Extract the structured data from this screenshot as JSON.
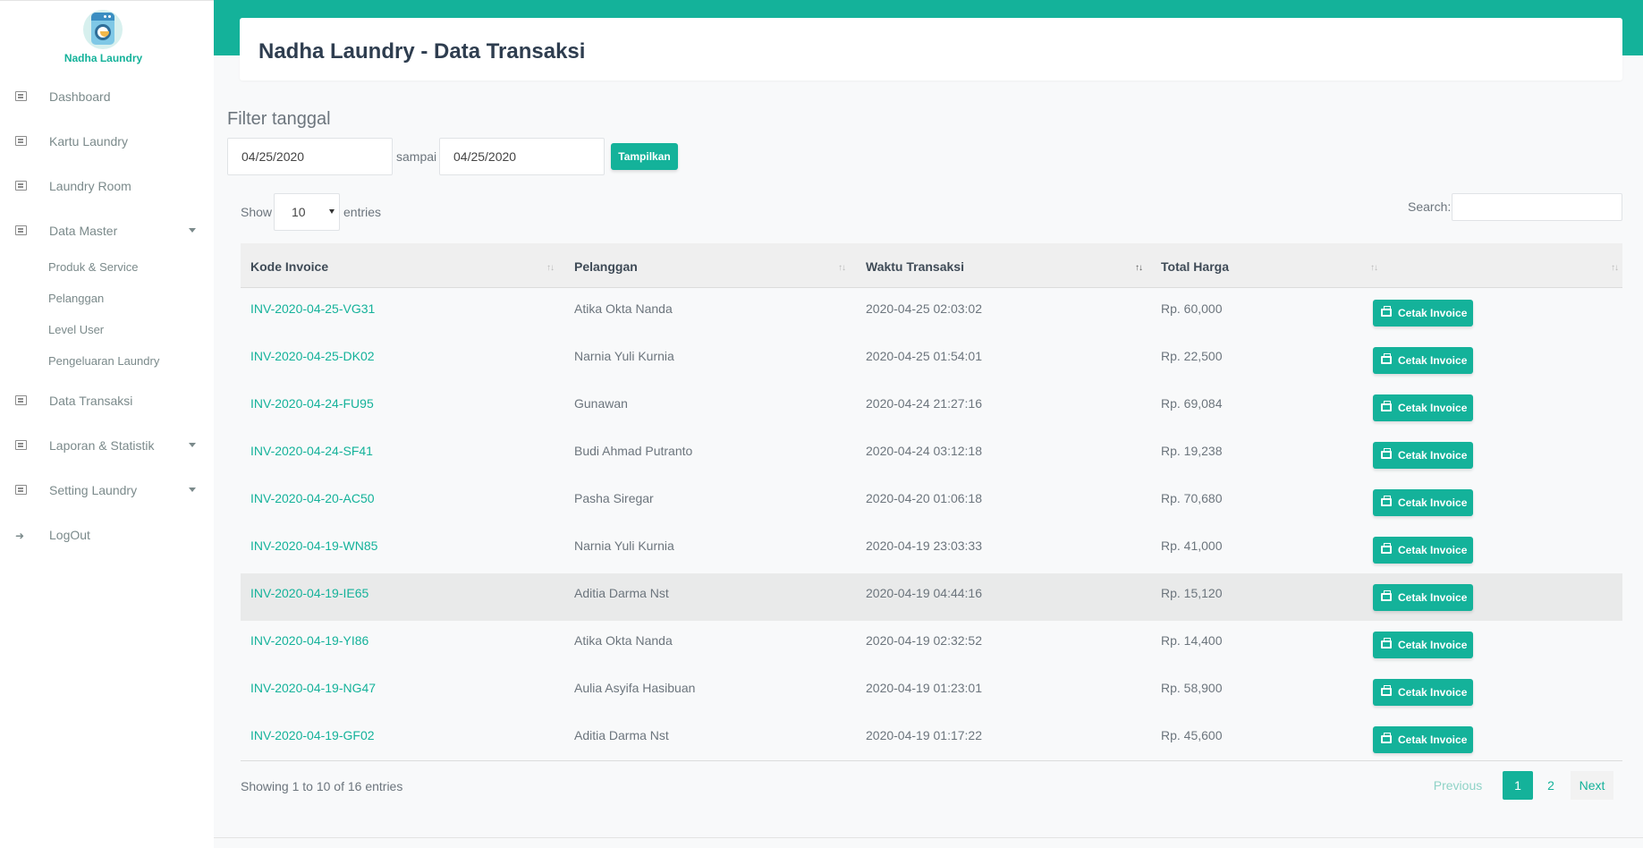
{
  "brand": {
    "name": "Nadha Laundry"
  },
  "sidebar": {
    "items": [
      {
        "label": "Dashboard",
        "icon": "list-icon"
      },
      {
        "label": "Kartu Laundry",
        "icon": "list-icon"
      },
      {
        "label": "Laundry Room",
        "icon": "list-icon"
      },
      {
        "label": "Data Master",
        "icon": "list-icon",
        "expanded": true
      },
      {
        "label": "Data Transaksi",
        "icon": "list-icon"
      },
      {
        "label": "Laporan & Statistik",
        "icon": "list-icon"
      },
      {
        "label": "Setting Laundry",
        "icon": "list-icon"
      },
      {
        "label": "LogOut",
        "icon": "logout-icon"
      }
    ],
    "submenu": [
      "Produk & Service",
      "Pelanggan",
      "Level User",
      "Pengeluaran Laundry"
    ]
  },
  "header": {
    "title": "Nadha Laundry - Data Transaksi"
  },
  "filter": {
    "title": "Filter tanggal",
    "date_from": "04/25/2020",
    "separator": "sampai",
    "date_to": "04/25/2020",
    "button": "Tampilkan"
  },
  "table_controls": {
    "show_label": "Show",
    "entries_value": "10",
    "entries_label": "entries",
    "search_label": "Search:"
  },
  "table": {
    "columns": [
      "Kode Invoice",
      "Pelanggan",
      "Waktu Transaksi",
      "Total Harga",
      ""
    ],
    "action_label": "Cetak Invoice",
    "rows": [
      [
        "INV-2020-04-25-VG31",
        "Atika Okta Nanda",
        "2020-04-25 02:03:02",
        "Rp. 60,000"
      ],
      [
        "INV-2020-04-25-DK02",
        "Narnia Yuli Kurnia",
        "2020-04-25 01:54:01",
        "Rp. 22,500"
      ],
      [
        "INV-2020-04-24-FU95",
        "Gunawan",
        "2020-04-24 21:27:16",
        "Rp. 69,084"
      ],
      [
        "INV-2020-04-24-SF41",
        "Budi Ahmad Putranto",
        "2020-04-24 03:12:18",
        "Rp. 19,238"
      ],
      [
        "INV-2020-04-20-AC50",
        "Pasha Siregar",
        "2020-04-20 01:06:18",
        "Rp. 70,680"
      ],
      [
        "INV-2020-04-19-WN85",
        "Narnia Yuli Kurnia",
        "2020-04-19 23:03:33",
        "Rp. 41,000"
      ],
      [
        "INV-2020-04-19-IE65",
        "Aditia Darma Nst",
        "2020-04-19 04:44:16",
        "Rp. 15,120"
      ],
      [
        "INV-2020-04-19-YI86",
        "Atika Okta Nanda",
        "2020-04-19 02:32:52",
        "Rp. 14,400"
      ],
      [
        "INV-2020-04-19-NG47",
        "Aulia Asyifa Hasibuan",
        "2020-04-19 01:23:01",
        "Rp. 58,900"
      ],
      [
        "INV-2020-04-19-GF02",
        "Aditia Darma Nst",
        "2020-04-19 01:17:22",
        "Rp. 45,600"
      ]
    ]
  },
  "pagination": {
    "info": "Showing 1 to 10 of 16 entries",
    "previous": "Previous",
    "pages": [
      "1",
      "2"
    ],
    "next": "Next",
    "current": "1"
  },
  "colors": {
    "accent": "#14b29a",
    "title": "#2e3d4f",
    "text": "#6c757d"
  }
}
